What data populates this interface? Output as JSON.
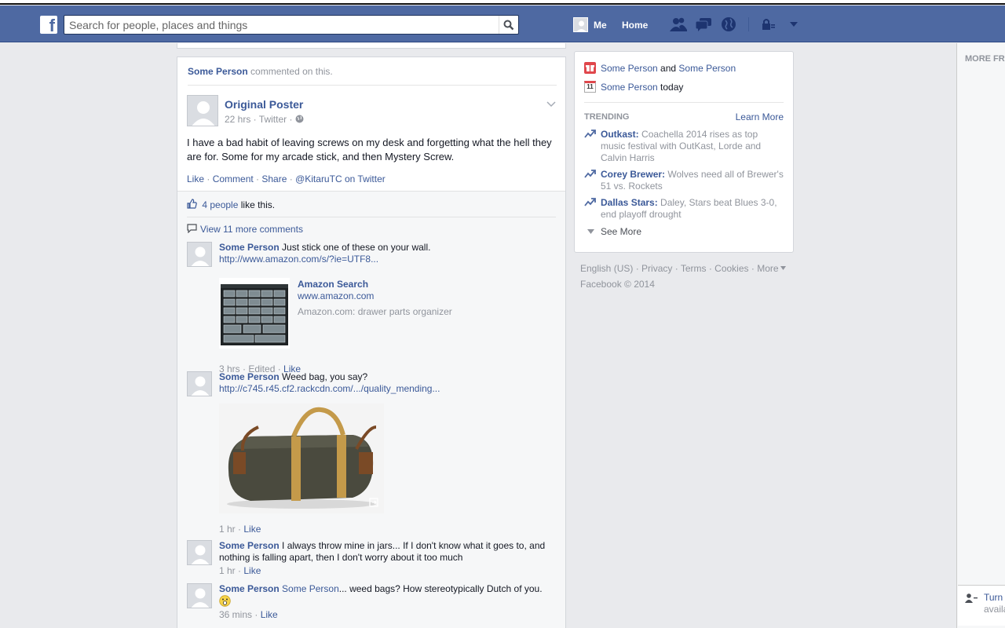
{
  "header": {
    "search_placeholder": "Search for people, places and things",
    "me_label": "Me",
    "home_label": "Home"
  },
  "story": {
    "header_actor": "Some Person",
    "header_text": "commented on this.",
    "poster_name": "Original Poster",
    "poster_meta": "22 hrs · Twitter ·",
    "text": "I have a bad habit of leaving screws on my desk and forgetting what the hell they are for. Some for my arcade stick, and then Mystery Screw.",
    "actions": {
      "like": "Like",
      "comment": "Comment",
      "share": "Share",
      "via": "@KitaruTC on Twitter"
    },
    "likes_count": "4 people",
    "likes_suffix": "like this.",
    "view_more": "View 11 more comments"
  },
  "comments": [
    {
      "author": "Some Person",
      "text": "Just stick one of these on your wall.",
      "url": "http://www.amazon.com/s/?ie=UTF8...",
      "share_title": "Amazon Search",
      "share_domain": "www.amazon.com",
      "share_desc": "Amazon.com: drawer parts organizer",
      "meta": "3 hrs · Edited ·",
      "like": "Like"
    },
    {
      "author": "Some Person",
      "text": "Weed bag, you say?",
      "url": "http://c745.r45.cf2.rackcdn.com/.../quality_mending...",
      "meta": "1 hr ·",
      "like": "Like"
    },
    {
      "author": "Some Person",
      "text": "I always throw mine in jars... If I don't know what it goes to, and nothing is falling apart, then I don't worry about it too much",
      "meta": "1 hr ·",
      "like": "Like"
    },
    {
      "author": "Some Person",
      "mention": "Some Person",
      "text": "... weed bags? How stereotypically Dutch of you.",
      "meta": "36 mins ·",
      "like": "Like"
    }
  ],
  "sidebar": {
    "birthday": {
      "name1": "Some Person",
      "and": "and",
      "name2": "Some Person"
    },
    "event": {
      "name": "Some Person",
      "when": "today",
      "calendar_day": "11"
    },
    "trending_label": "TRENDING",
    "learn_more": "Learn More",
    "trends": [
      {
        "topic": "Outkast:",
        "text": "Coachella 2014 rises as top music festival with OutKast, Lorde and Calvin Harris"
      },
      {
        "topic": "Corey Brewer:",
        "text": "Wolves need all of Brewer's 51 vs. Rockets"
      },
      {
        "topic": "Dallas Stars:",
        "text": "Daley, Stars beat Blues 3-0, end playoff drought"
      }
    ],
    "see_more": "See More"
  },
  "footer": {
    "links": [
      "English (US)",
      "Privacy",
      "Terms",
      "Cookies",
      "More"
    ],
    "copyright": "Facebook © 2014"
  },
  "far_right": {
    "label": "MORE FRI",
    "chat_turn": "Turn",
    "chat_avail": "availa"
  },
  "colors": {
    "bluebar": "#4e69a2",
    "link": "#3b5998",
    "background": "#e9eaed"
  }
}
